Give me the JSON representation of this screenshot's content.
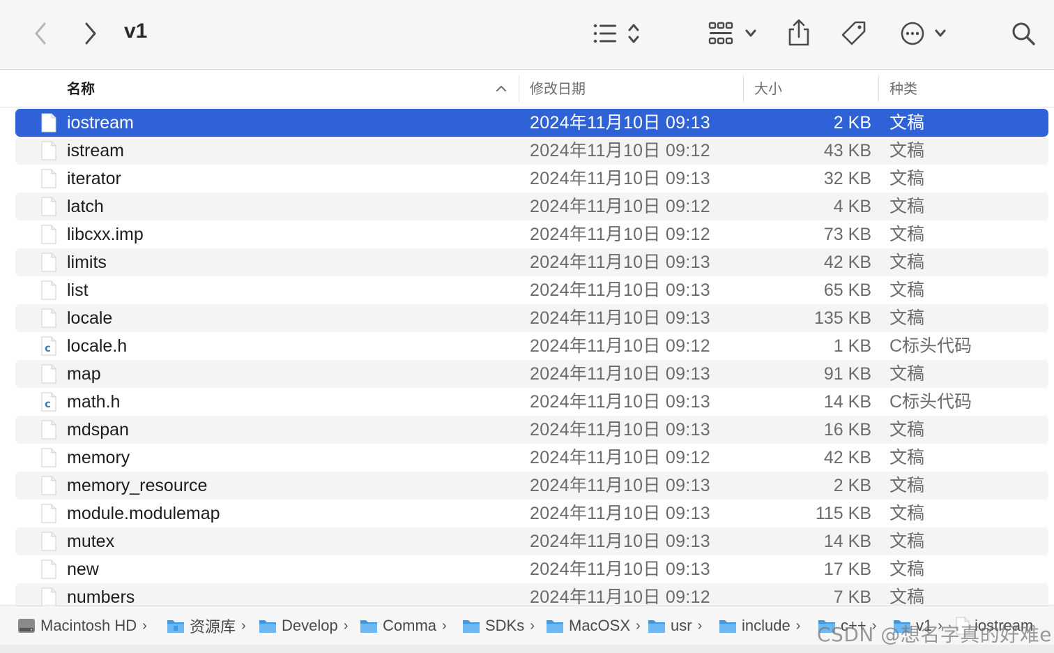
{
  "window": {
    "title": "v1"
  },
  "toolbar": {
    "back_icon": "chevron-left-icon",
    "forward_icon": "chevron-right-icon",
    "view_icon": "list-view-icon",
    "group_icon": "grid-group-icon",
    "share_icon": "share-icon",
    "tag_icon": "tag-icon",
    "more_icon": "ellipsis-circle-icon",
    "search_icon": "search-icon"
  },
  "columns": {
    "name": "名称",
    "date": "修改日期",
    "size": "大小",
    "kind": "种类"
  },
  "files": [
    {
      "name": "iostream",
      "date": "2024年11月10日 09:13",
      "size": "2 KB",
      "kind": "文稿",
      "icon": "document-icon",
      "selected": true
    },
    {
      "name": "istream",
      "date": "2024年11月10日 09:12",
      "size": "43 KB",
      "kind": "文稿",
      "icon": "document-icon"
    },
    {
      "name": "iterator",
      "date": "2024年11月10日 09:13",
      "size": "32 KB",
      "kind": "文稿",
      "icon": "document-icon"
    },
    {
      "name": "latch",
      "date": "2024年11月10日 09:12",
      "size": "4 KB",
      "kind": "文稿",
      "icon": "document-icon"
    },
    {
      "name": "libcxx.imp",
      "date": "2024年11月10日 09:12",
      "size": "73 KB",
      "kind": "文稿",
      "icon": "document-icon"
    },
    {
      "name": "limits",
      "date": "2024年11月10日 09:13",
      "size": "42 KB",
      "kind": "文稿",
      "icon": "document-icon"
    },
    {
      "name": "list",
      "date": "2024年11月10日 09:13",
      "size": "65 KB",
      "kind": "文稿",
      "icon": "document-icon"
    },
    {
      "name": "locale",
      "date": "2024年11月10日 09:13",
      "size": "135 KB",
      "kind": "文稿",
      "icon": "document-icon"
    },
    {
      "name": "locale.h",
      "date": "2024年11月10日 09:12",
      "size": "1 KB",
      "kind": "C标头代码",
      "icon": "c-header-icon"
    },
    {
      "name": "map",
      "date": "2024年11月10日 09:13",
      "size": "91 KB",
      "kind": "文稿",
      "icon": "document-icon"
    },
    {
      "name": "math.h",
      "date": "2024年11月10日 09:13",
      "size": "14 KB",
      "kind": "C标头代码",
      "icon": "c-header-icon"
    },
    {
      "name": "mdspan",
      "date": "2024年11月10日 09:13",
      "size": "16 KB",
      "kind": "文稿",
      "icon": "document-icon"
    },
    {
      "name": "memory",
      "date": "2024年11月10日 09:12",
      "size": "42 KB",
      "kind": "文稿",
      "icon": "document-icon"
    },
    {
      "name": "memory_resource",
      "date": "2024年11月10日 09:13",
      "size": "2 KB",
      "kind": "文稿",
      "icon": "document-icon"
    },
    {
      "name": "module.modulemap",
      "date": "2024年11月10日 09:13",
      "size": "115 KB",
      "kind": "文稿",
      "icon": "document-icon"
    },
    {
      "name": "mutex",
      "date": "2024年11月10日 09:13",
      "size": "14 KB",
      "kind": "文稿",
      "icon": "document-icon"
    },
    {
      "name": "new",
      "date": "2024年11月10日 09:13",
      "size": "17 KB",
      "kind": "文稿",
      "icon": "document-icon"
    },
    {
      "name": "numbers",
      "date": "2024年11月10日 09:12",
      "size": "7 KB",
      "kind": "文稿",
      "icon": "document-icon"
    }
  ],
  "path_bar": [
    {
      "label": "Macintosh HD",
      "icon": "hard-drive-icon"
    },
    {
      "label": "资源库",
      "icon": "library-folder-icon"
    },
    {
      "label": "Develop",
      "icon": "folder-icon"
    },
    {
      "label": "Comma",
      "icon": "folder-icon"
    },
    {
      "label": "SDKs",
      "icon": "folder-icon"
    },
    {
      "label": "MacOSX",
      "icon": "folder-icon"
    },
    {
      "label": "usr",
      "icon": "folder-icon"
    },
    {
      "label": "include",
      "icon": "folder-icon"
    },
    {
      "label": "c++",
      "icon": "folder-icon"
    },
    {
      "label": "v1",
      "icon": "folder-icon"
    },
    {
      "label": "iostream",
      "icon": "document-icon"
    }
  ],
  "watermark": "CSDN @想名字真的好难e",
  "colors": {
    "selection": "#2f62d6",
    "folder": "#3a9ae8",
    "c_icon": "#3b7fb8"
  }
}
